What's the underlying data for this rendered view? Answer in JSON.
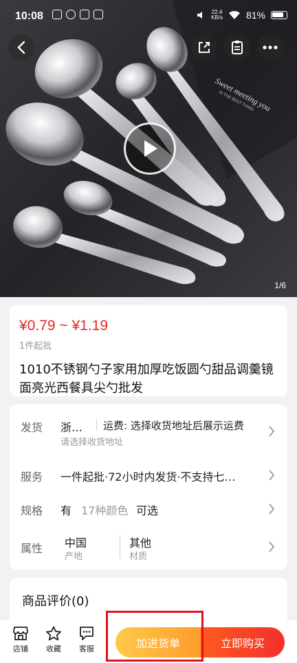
{
  "status_bar": {
    "time": "10:08",
    "net_speed_value": "22.4",
    "net_speed_unit": "KB/s",
    "battery": "81%"
  },
  "gallery": {
    "page_indicator": "1/6",
    "photo_text_line1": "Sweet meeting you",
    "photo_text_line2": "IS THE BEST THING"
  },
  "product": {
    "price": "¥0.79 ~ ¥1.19",
    "min_order": "1件起批",
    "title": "1010不锈钢勺子家用加厚吃饭圆勺甜品调羹镜面亮光西餐具尖勺批发"
  },
  "details": {
    "shipping": {
      "label": "发货",
      "origin": "浙…",
      "freight": "运费: 选择收货地址后展示运费",
      "hint": "请选择收货地址"
    },
    "service": {
      "label": "服务",
      "value": "一件起批·72小时内发货·不支持七…"
    },
    "spec": {
      "label": "规格",
      "has": "有",
      "count": "17种颜色",
      "selectable": "可选"
    },
    "attributes": {
      "label": "属性",
      "origin_value": "中国",
      "origin_name": "产地",
      "material_value": "其他",
      "material_name": "材质"
    }
  },
  "reviews": {
    "title": "商品评价(0)"
  },
  "bottom_bar": {
    "store": "店铺",
    "favorite": "收藏",
    "service": "客服",
    "add_to_cart": "加进货单",
    "buy_now": "立即购买"
  },
  "colors": {
    "price_red": "#e8271f",
    "cart_orange": "#ffb13b",
    "buy_red": "#f2302c",
    "highlight": "#e3101c"
  }
}
